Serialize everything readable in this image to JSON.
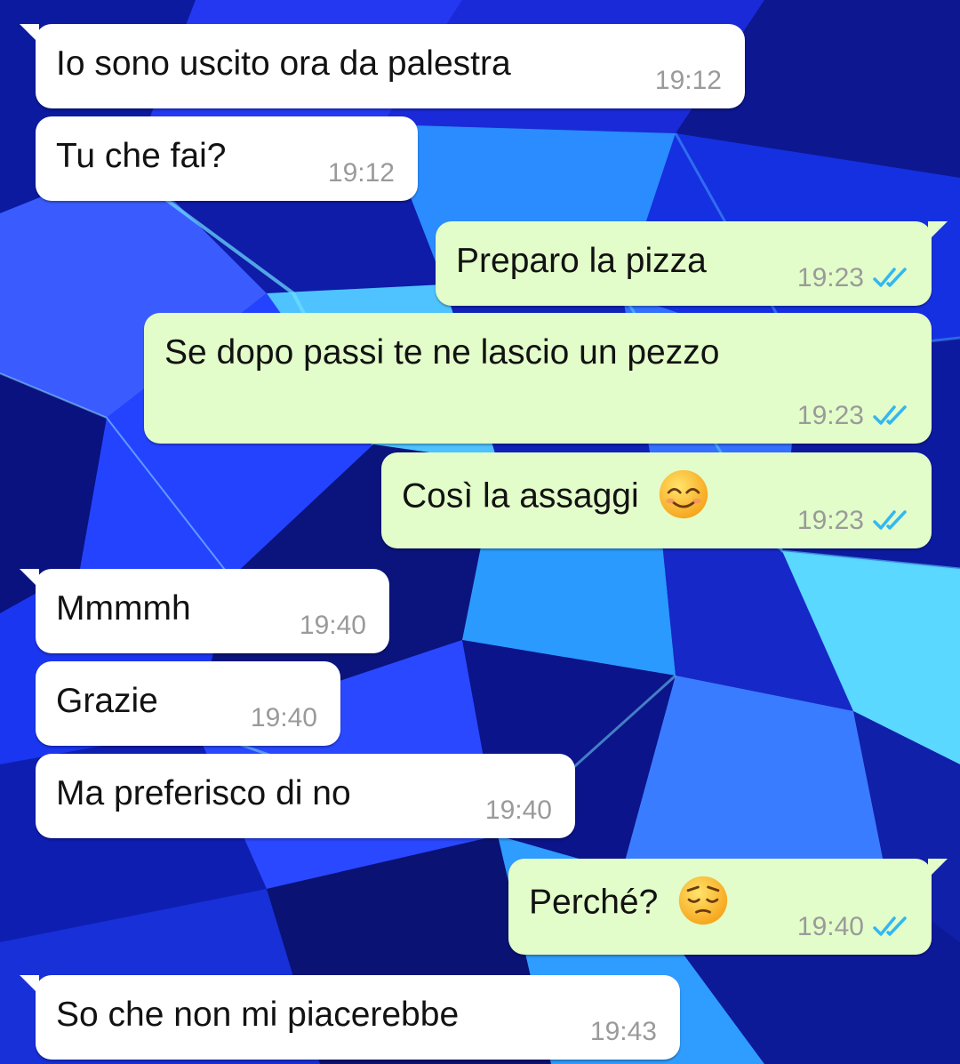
{
  "chat": {
    "wallpaper": {
      "base_color": "#1426c8",
      "accent_colors": [
        "#0a14a0",
        "#2b46ff",
        "#3aa8ff",
        "#5ad8ff",
        "#0b1470",
        "#1c3cff"
      ]
    },
    "colors": {
      "incoming_bubble": "#ffffff",
      "outgoing_bubble": "#e2fdc9",
      "time": "#9a9a9a",
      "read_ticks": "#34b7f1"
    },
    "messages": [
      {
        "direction": "incoming",
        "text": "Io sono uscito ora da palestra",
        "time": "19:12"
      },
      {
        "direction": "incoming",
        "text": "Tu che fai?",
        "time": "19:12"
      },
      {
        "direction": "outgoing",
        "text": "Preparo la pizza",
        "time": "19:23",
        "status_icon": "double-check-read-icon"
      },
      {
        "direction": "outgoing",
        "text": "Se dopo passi te ne lascio un pezzo",
        "time": "19:23",
        "status_icon": "double-check-read-icon"
      },
      {
        "direction": "outgoing",
        "text": "Così la assaggi",
        "emoji": "smiling-face-icon",
        "time": "19:23",
        "status_icon": "double-check-read-icon"
      },
      {
        "direction": "incoming",
        "text": "Mmmmh",
        "time": "19:40"
      },
      {
        "direction": "incoming",
        "text": "Grazie",
        "time": "19:40"
      },
      {
        "direction": "incoming",
        "text": "Ma preferisco di no",
        "time": "19:40"
      },
      {
        "direction": "outgoing",
        "text": "Perché?",
        "emoji": "pensive-face-icon",
        "time": "19:40",
        "status_icon": "double-check-read-icon"
      },
      {
        "direction": "incoming",
        "text": "So che non mi piacerebbe",
        "time": "19:43"
      }
    ]
  }
}
